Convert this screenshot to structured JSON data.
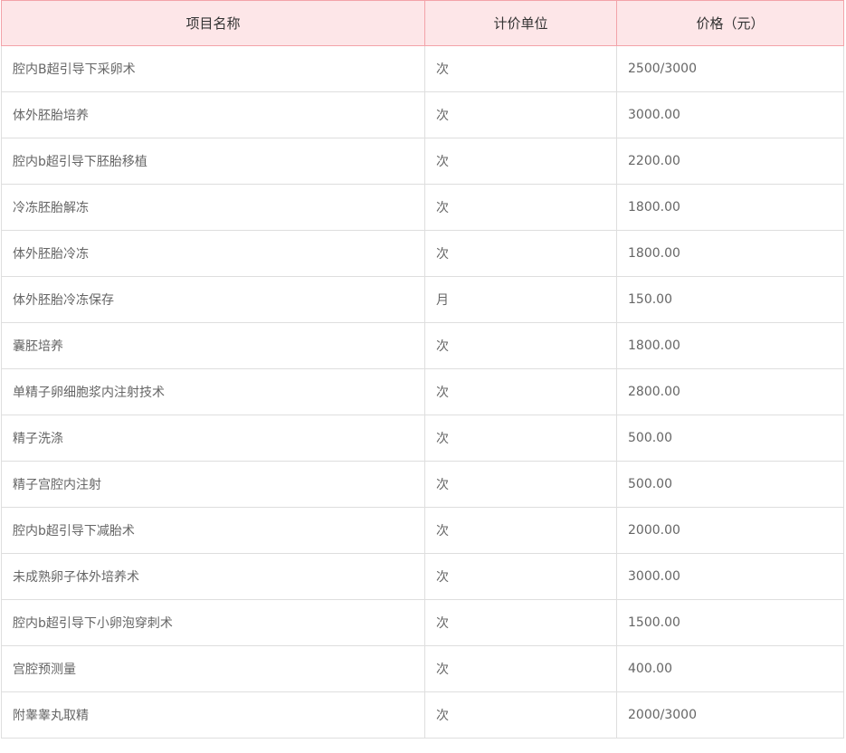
{
  "table": {
    "headers": [
      "项目名称",
      "计价单位",
      "价格（元）"
    ],
    "rows": [
      {
        "name": "腔内B超引导下采卵术",
        "unit": "次",
        "price": "2500/3000"
      },
      {
        "name": "体外胚胎培养",
        "unit": "次",
        "price": "3000.00"
      },
      {
        "name": "腔内b超引导下胚胎移植",
        "unit": "次",
        "price": "2200.00"
      },
      {
        "name": "冷冻胚胎解冻",
        "unit": "次",
        "price": "1800.00"
      },
      {
        "name": "体外胚胎冷冻",
        "unit": "次",
        "price": "1800.00"
      },
      {
        "name": "体外胚胎冷冻保存",
        "unit": "月",
        "price": "150.00"
      },
      {
        "name": "囊胚培养",
        "unit": "次",
        "price": "1800.00"
      },
      {
        "name": "单精子卵细胞浆内注射技术",
        "unit": "次",
        "price": "2800.00"
      },
      {
        "name": "精子洗涤",
        "unit": "次",
        "price": "500.00"
      },
      {
        "name": "精子宫腔内注射",
        "unit": "次",
        "price": "500.00"
      },
      {
        "name": "腔内b超引导下减胎术",
        "unit": "次",
        "price": "2000.00"
      },
      {
        "name": "未成熟卵子体外培养术",
        "unit": "次",
        "price": "3000.00"
      },
      {
        "name": "腔内b超引导下小卵泡穿刺术",
        "unit": "次",
        "price": "1500.00"
      },
      {
        "name": "宫腔预测量",
        "unit": "次",
        "price": "400.00"
      },
      {
        "name": "附睾睾丸取精",
        "unit": "次",
        "price": "2000/3000"
      }
    ]
  }
}
